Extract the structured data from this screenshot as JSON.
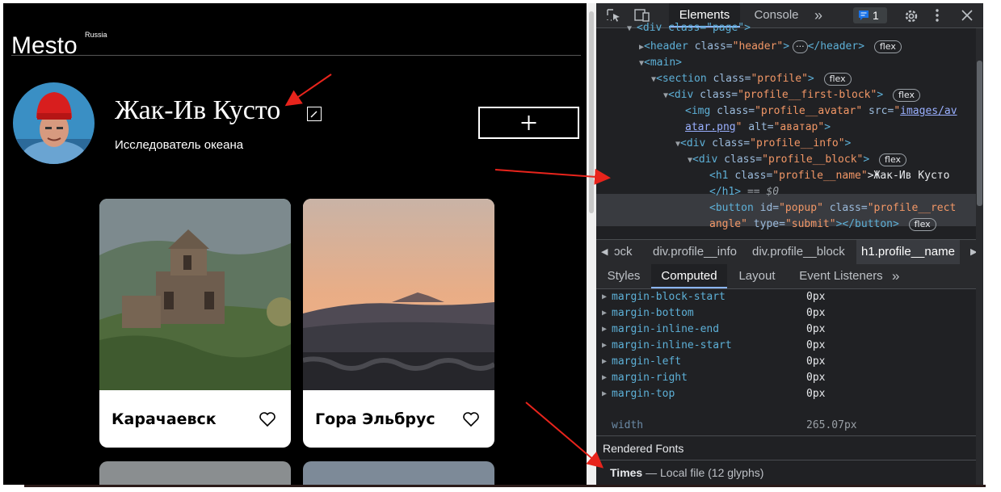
{
  "page": {
    "logo": "Mesto",
    "logo_sup": "Russia",
    "profile_name": "Жак-Ив Кусто",
    "profile_about": "Исследователь океана",
    "add_symbol": "+",
    "cards": [
      {
        "title": "Карачаевск"
      },
      {
        "title": "Гора Эльбрус"
      }
    ]
  },
  "devtools": {
    "tabs": [
      "Elements",
      "Console"
    ],
    "more_tabs": "»",
    "issues_count": "1",
    "dom_lines": {
      "l0_tag": "<div class=\"page\">",
      "l1_open": "<header",
      "l1_attr": "class=",
      "l1_val": "\"header\"",
      "l1_mid": ">",
      "l1_ellipsis": "···",
      "l1_close": "</header>",
      "l2_tag": "<main>",
      "l3_open": "<section",
      "l3_attr": "class=",
      "l3_val": "\"profile\"",
      "l3_close": ">",
      "l4_open": "<div",
      "l4_attr": "class=",
      "l4_val": "\"profile__first-block\"",
      "l4_close": ">",
      "l5_open": "<img",
      "l5_attr1": "class=",
      "l5_val1": "\"profile__avatar\"",
      "l5_attr2": "src=",
      "l5_link1": "images/av",
      "l6_link2": "atar.png",
      "l6_attr": "alt=",
      "l6_val": "\"аватар\"",
      "l6_close": ">",
      "l7_open": "<div",
      "l7_attr": "class=",
      "l7_val": "\"profile__info\"",
      "l7_close": ">",
      "l8_open": "<div",
      "l8_attr": "class=",
      "l8_val": "\"profile__block\"",
      "l8_close": ">",
      "l9_open": "<h1",
      "l9_attr": "class=",
      "l9_val": "\"profile__name\"",
      "l9_text": ">Жак-Ив Кусто",
      "l10_close": "</h1>",
      "l10_eq": "== $0",
      "l11_open": "<button",
      "l11_attr1": "id=",
      "l11_val1": "\"popup\"",
      "l11_attr2": "class=",
      "l11_val2": "\"profile__rect",
      "l12_val": "angle\"",
      "l12_attr": "type=",
      "l12_val2": "\"submit\"",
      "l12_close": "></button>",
      "pill": "flex"
    },
    "breadcrumbs": [
      "ɔck",
      "div.profile__info",
      "div.profile__block",
      "h1.profile__name"
    ],
    "subtabs": [
      "Styles",
      "Computed",
      "Layout",
      "Event Listeners"
    ],
    "computed": [
      {
        "name": "margin-block-start",
        "value": "0px"
      },
      {
        "name": "margin-bottom",
        "value": "0px"
      },
      {
        "name": "margin-inline-end",
        "value": "0px"
      },
      {
        "name": "margin-inline-start",
        "value": "0px"
      },
      {
        "name": "margin-left",
        "value": "0px"
      },
      {
        "name": "margin-right",
        "value": "0px"
      },
      {
        "name": "margin-top",
        "value": "0px"
      }
    ],
    "width_prop": {
      "name": "width",
      "value": "265.07px"
    },
    "rendered_fonts_title": "Rendered Fonts",
    "rendered_font_name": "Times",
    "rendered_font_detail": "— Local file (12 glyphs)"
  },
  "colors": {
    "devtools_bg": "#202124",
    "tag": "#5db0d7",
    "attr_value": "#f29766",
    "selection": "#393b40",
    "annotation_arrow": "#e8241c"
  }
}
